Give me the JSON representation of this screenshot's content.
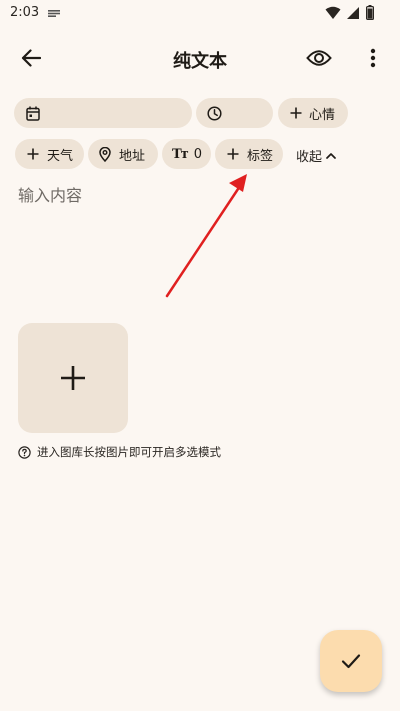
{
  "status_bar": {
    "time": "2:03",
    "icons": [
      "notification-icon",
      "wifi-icon",
      "signal-icon",
      "battery-icon"
    ]
  },
  "app_bar": {
    "title": "纯文本",
    "icons": [
      "back-arrow-icon",
      "eye-icon",
      "more-vert-icon"
    ]
  },
  "chips": {
    "date_label": "",
    "time_label": "",
    "mood_label": "心情",
    "weather_label": "天气",
    "address_label": "地址",
    "count_value": "0",
    "tag_label": "标签"
  },
  "collapse_label": "收起",
  "content": {
    "placeholder": "输入内容",
    "value": ""
  },
  "image_hint": "进入图库长按图片即可开启多选模式",
  "colors": {
    "background": "#fcf7f2",
    "chip": "#eee3d6",
    "fab": "#fcdcae",
    "annotation_arrow": "#e02020"
  }
}
